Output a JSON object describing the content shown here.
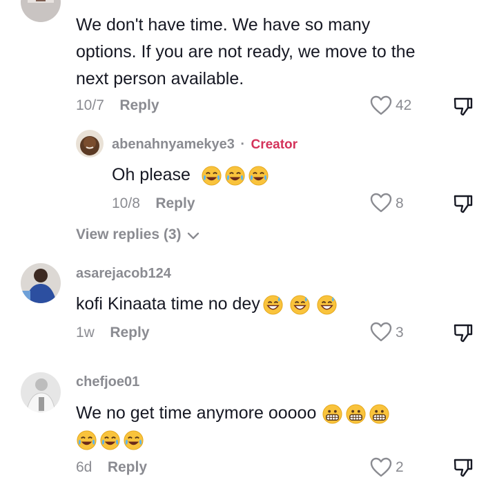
{
  "comments": [
    {
      "avatar": "user-avatar-photo",
      "text": "We don't have time. We have so many options. If you are not ready, we move to the next person available.",
      "date": "10/7",
      "reply_label": "Reply",
      "likes": "42",
      "reply": {
        "username": "abenahnyamekye3",
        "separator": "·",
        "badge": "Creator",
        "text": "Oh please",
        "emoji": [
          "face-with-tears-of-joy",
          "face-with-tears-of-joy",
          "face-with-tears-of-joy"
        ],
        "date": "10/8",
        "reply_label": "Reply",
        "likes": "8"
      },
      "view_replies": "View replies (3)"
    },
    {
      "username": "asarejacob124",
      "text": "kofi Kinaata time no dey",
      "emoji": [
        "grinning-face-with-sweat",
        "grinning-face-with-sweat",
        "grinning-face-with-sweat"
      ],
      "date": "1w",
      "reply_label": "Reply",
      "likes": "3"
    },
    {
      "username": "chefjoe01",
      "text": "We no get time anymore ooooo",
      "emoji_line1": [
        "grimacing-face",
        "grimacing-face",
        "grimacing-face"
      ],
      "emoji_line2": [
        "face-with-tears-of-joy",
        "face-with-tears-of-joy",
        "face-with-tears-of-joy"
      ],
      "date": "6d",
      "reply_label": "Reply",
      "likes": "2"
    }
  ],
  "icons": {
    "like": "heart-outline-icon",
    "dislike": "thumbs-down-icon",
    "chevron": "chevron-down-icon"
  },
  "colors": {
    "creator_badge": "#d4325a",
    "secondary_text": "#8a8b91",
    "primary_text": "#161823"
  }
}
